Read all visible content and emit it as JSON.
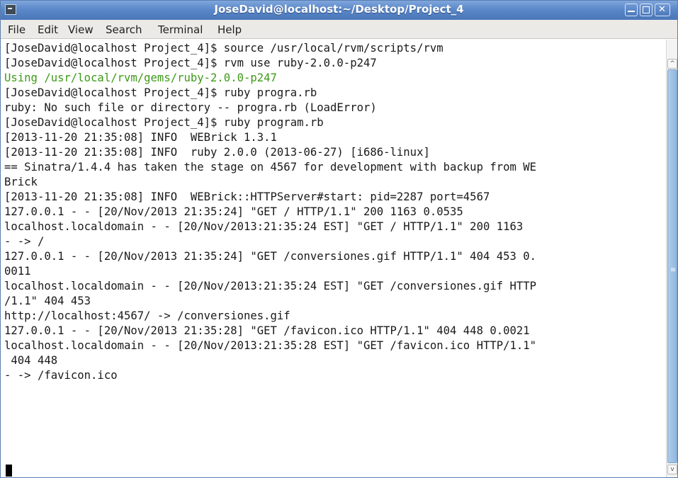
{
  "window": {
    "title": "JoseDavid@localhost:~/Desktop/Project_4",
    "icon": "terminal-icon",
    "controls": [
      "minimize-icon",
      "maximize-icon",
      "close-icon"
    ],
    "close_glyph": "✕"
  },
  "menu": [
    "File",
    "Edit",
    "View",
    "Search",
    "Terminal",
    "Help"
  ],
  "terminal": {
    "lines": [
      "[JoseDavid@localhost Project_4]$ source /usr/local/rvm/scripts/rvm",
      "[JoseDavid@localhost Project_4]$ rvm use ruby-2.0.0-p247",
      "Using /usr/local/rvm/gems/ruby-2.0.0-p247",
      "[JoseDavid@localhost Project_4]$ ruby progra.rb",
      "ruby: No such file or directory -- progra.rb (LoadError)",
      "[JoseDavid@localhost Project_4]$ ruby program.rb",
      "[2013-11-20 21:35:08] INFO  WEBrick 1.3.1",
      "[2013-11-20 21:35:08] INFO  ruby 2.0.0 (2013-06-27) [i686-linux]",
      "== Sinatra/1.4.4 has taken the stage on 4567 for development with backup from WE",
      "Brick",
      "[2013-11-20 21:35:08] INFO  WEBrick::HTTPServer#start: pid=2287 port=4567",
      "127.0.0.1 - - [20/Nov/2013 21:35:24] \"GET / HTTP/1.1\" 200 1163 0.0535",
      "localhost.localdomain - - [20/Nov/2013:21:35:24 EST] \"GET / HTTP/1.1\" 200 1163",
      "- -> /",
      "127.0.0.1 - - [20/Nov/2013 21:35:24] \"GET /conversiones.gif HTTP/1.1\" 404 453 0.",
      "0011",
      "localhost.localdomain - - [20/Nov/2013:21:35:24 EST] \"GET /conversiones.gif HTTP",
      "/1.1\" 404 453",
      "http://localhost:4567/ -> /conversiones.gif",
      "127.0.0.1 - - [20/Nov/2013 21:35:28] \"GET /favicon.ico HTTP/1.1\" 404 448 0.0021",
      "localhost.localdomain - - [20/Nov/2013:21:35:28 EST] \"GET /favicon.ico HTTP/1.1\"",
      " 404 448",
      "- -> /favicon.ico"
    ],
    "highlight_line_index": 2,
    "highlight_color": "#3d9a17"
  },
  "scrollbar": {
    "up_glyph": "^",
    "down_glyph": "v",
    "grip_glyph": "≡",
    "thumb_color": "#9fc3e8"
  }
}
